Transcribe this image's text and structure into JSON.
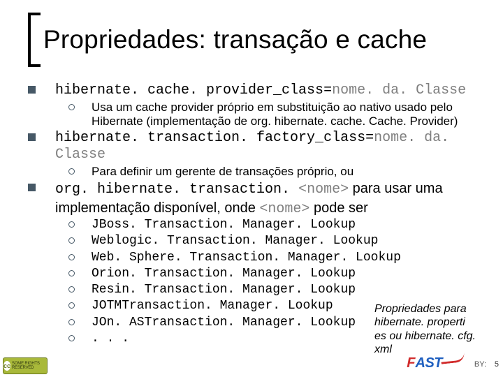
{
  "title": "Propriedades: transação e cache",
  "items": [
    {
      "prop": "hibernate. cache. provider_class=",
      "val": "nome. da. Classe",
      "sub": [
        "Usa um cache provider próprio em substituição ao nativo usado pelo Hibernate (implementação de org. hibernate. cache. Cache. Provider)"
      ]
    },
    {
      "prop": "hibernate. transaction. factory_class=",
      "val": "nome. da. Classe",
      "sub": [
        "Para definir um gerente de transações próprio, ou"
      ]
    }
  ],
  "line3": {
    "prefix": "org. hibernate. transaction. ",
    "param1": "<nome>",
    "mid1": " para usar uma",
    "cont": "implementação disponível, onde ",
    "param2": "<nome>",
    "suffix": " pode ser"
  },
  "managers": [
    "JBoss. Transaction. Manager. Lookup",
    "Weblogic. Transaction. Manager. Lookup",
    "Web. Sphere. Transaction. Manager. Lookup",
    "Orion. Transaction. Manager. Lookup",
    "Resin. Transaction. Manager. Lookup",
    "JOTMTransaction. Manager. Lookup",
    "JOn. ASTransaction. Manager. Lookup",
    ". . ."
  ],
  "callout": "Propriedades para hibernate. properti es ou hibernate. cfg. xml",
  "footer": {
    "cc": "SOME RIGHTS RESERVED",
    "fast_red": "F",
    "fast_blue": "AST",
    "by": "BY:",
    "page": "5"
  }
}
